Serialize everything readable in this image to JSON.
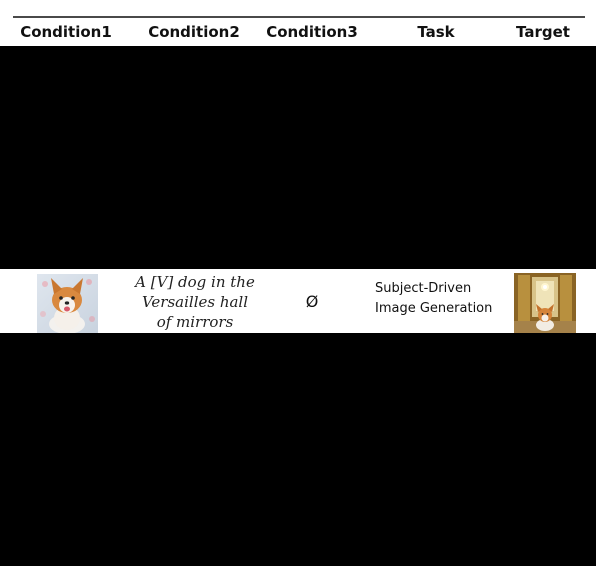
{
  "table": {
    "headers": [
      "Condition1",
      "Condition2",
      "Condition3",
      "Task",
      "Target"
    ],
    "row": {
      "condition1_image": "corgi-dog-photo",
      "condition2_lines": [
        "A [V] dog in the",
        "Versailles hall",
        "of mirrors"
      ],
      "condition3": "Ø",
      "task_lines": [
        "Subject-Driven",
        "Image Generation"
      ],
      "target_image": "corgi-in-hall-of-mirrors-photo"
    }
  }
}
